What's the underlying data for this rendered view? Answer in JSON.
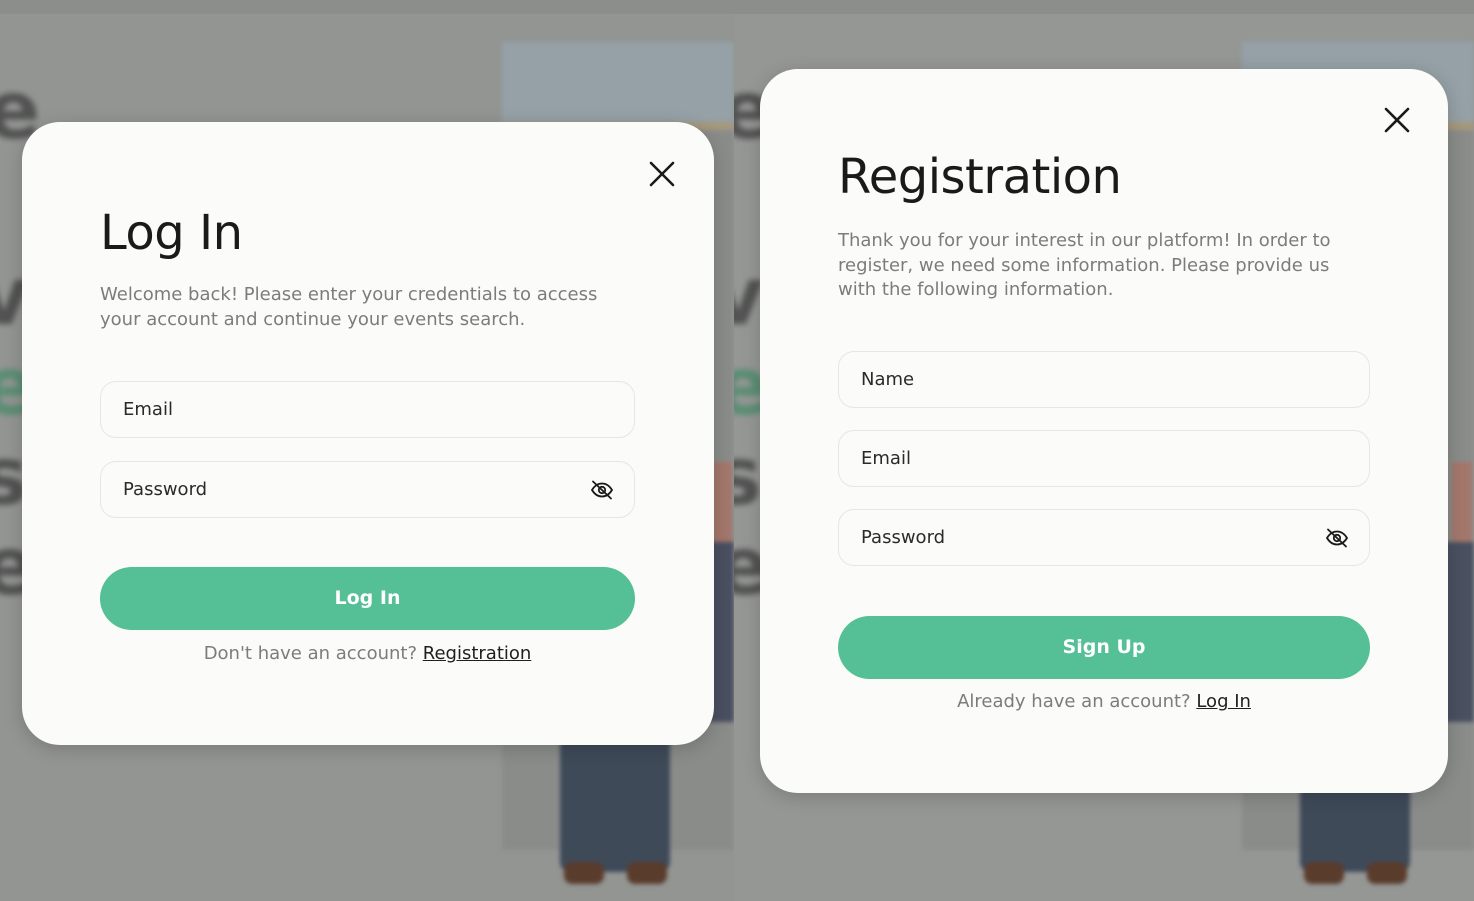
{
  "background": {
    "overlay_color": "#8f918f"
  },
  "login_modal": {
    "title": "Log In",
    "description": "Welcome back! Please enter your credentials to access your account and continue your events search.",
    "email_placeholder": "Email",
    "password_placeholder": "Password",
    "submit_label": "Log In",
    "switch_prompt": "Don't have an account?",
    "switch_link": "Registration",
    "close_icon": "close-icon",
    "password_toggle_icon": "eye-off-icon"
  },
  "register_modal": {
    "title": "Registration",
    "description": "Thank you for your interest in our platform! In order to register, we need some information. Please provide us with the following information.",
    "name_placeholder": "Name",
    "email_placeholder": "Email",
    "password_placeholder": "Password",
    "submit_label": "Sign Up",
    "switch_prompt": "Already have an account?",
    "switch_link": "Log In",
    "close_icon": "close-icon",
    "password_toggle_icon": "eye-off-icon"
  },
  "colors": {
    "accent": "#55bf96",
    "card": "#fbfbfa",
    "text_primary": "#1a1a1a",
    "text_secondary": "#7c7c7c"
  }
}
